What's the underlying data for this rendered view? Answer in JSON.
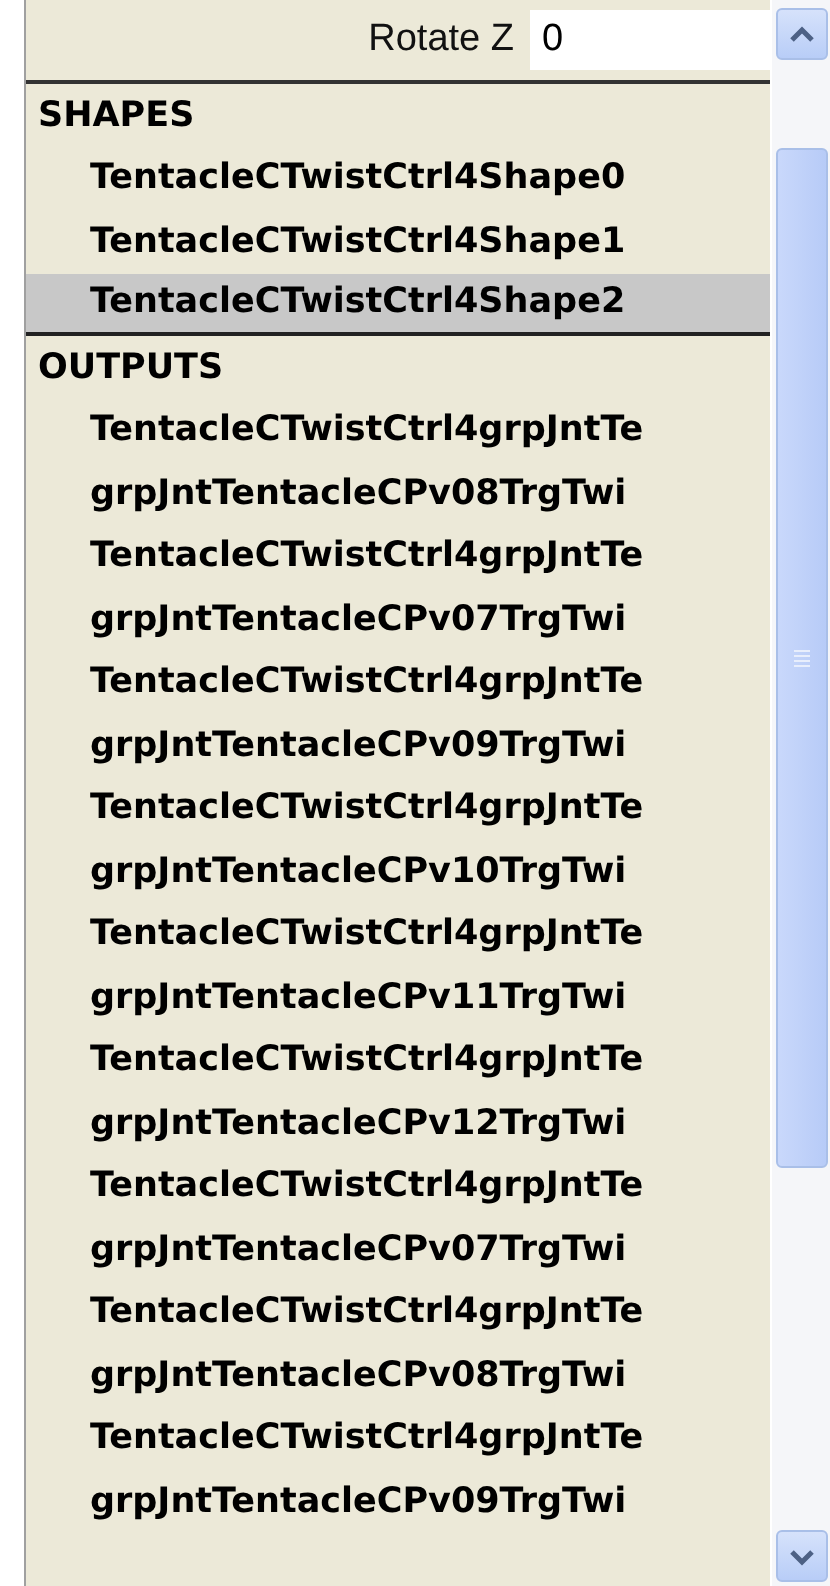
{
  "channel": {
    "label": "Rotate Z",
    "value": "0"
  },
  "sections": [
    {
      "title": "SHAPES",
      "items": [
        {
          "label": "TentacleCTwistCtrl4Shape0",
          "selected": false
        },
        {
          "label": "TentacleCTwistCtrl4Shape1",
          "selected": false
        },
        {
          "label": "TentacleCTwistCtrl4Shape2",
          "selected": true
        }
      ]
    },
    {
      "title": "OUTPUTS",
      "items": [
        {
          "label": "TentacleCTwistCtrl4grpJntTe",
          "selected": false
        },
        {
          "label": "grpJntTentacleCPv08TrgTwi",
          "selected": false
        },
        {
          "label": "TentacleCTwistCtrl4grpJntTe",
          "selected": false
        },
        {
          "label": "grpJntTentacleCPv07TrgTwi",
          "selected": false
        },
        {
          "label": "TentacleCTwistCtrl4grpJntTe",
          "selected": false
        },
        {
          "label": "grpJntTentacleCPv09TrgTwi",
          "selected": false
        },
        {
          "label": "TentacleCTwistCtrl4grpJntTe",
          "selected": false
        },
        {
          "label": "grpJntTentacleCPv10TrgTwi",
          "selected": false
        },
        {
          "label": "TentacleCTwistCtrl4grpJntTe",
          "selected": false
        },
        {
          "label": "grpJntTentacleCPv11TrgTwi",
          "selected": false
        },
        {
          "label": "TentacleCTwistCtrl4grpJntTe",
          "selected": false
        },
        {
          "label": "grpJntTentacleCPv12TrgTwi",
          "selected": false
        },
        {
          "label": "TentacleCTwistCtrl4grpJntTe",
          "selected": false
        },
        {
          "label": "grpJntTentacleCPv07TrgTwi",
          "selected": false
        },
        {
          "label": "TentacleCTwistCtrl4grpJntTe",
          "selected": false
        },
        {
          "label": "grpJntTentacleCPv08TrgTwi",
          "selected": false
        },
        {
          "label": "TentacleCTwistCtrl4grpJntTe",
          "selected": false
        },
        {
          "label": "grpJntTentacleCPv09TrgTwi",
          "selected": false
        }
      ]
    }
  ]
}
